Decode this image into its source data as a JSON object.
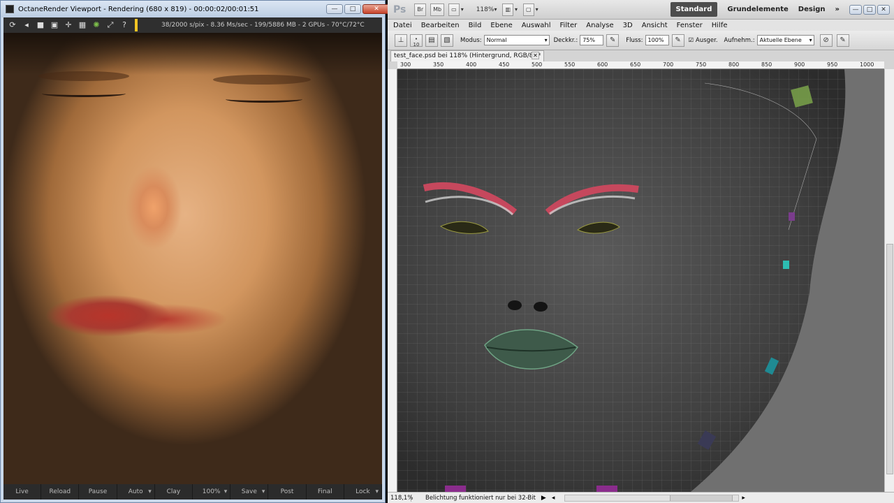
{
  "octane": {
    "title": "OctaneRender Viewport - Rendering (680 x 819) - 00:00:02/00:01:51",
    "buttons": {
      "minimize": "—",
      "maximize": "□",
      "close": "✕"
    },
    "toolbar_icons": [
      "refresh-icon",
      "back-icon",
      "stop-icon",
      "camera-icon",
      "crosshair-icon",
      "grid-icon",
      "color-wheel-icon",
      "expand-icon",
      "help-icon"
    ],
    "status": "38/2000 s/pix - 8.36 Ms/sec - 199/5886 MB - 2 GPUs - 70°C/72°C",
    "bottom_buttons": [
      {
        "label": "Live",
        "dropdown": false
      },
      {
        "label": "Reload",
        "dropdown": false
      },
      {
        "label": "Pause",
        "dropdown": false
      },
      {
        "label": "Auto",
        "dropdown": true
      },
      {
        "label": "Clay",
        "dropdown": false
      },
      {
        "label": "100%",
        "dropdown": true
      },
      {
        "label": "Save",
        "dropdown": true
      },
      {
        "label": "Post",
        "dropdown": false
      },
      {
        "label": "Final",
        "dropdown": false
      },
      {
        "label": "Lock",
        "dropdown": true
      }
    ]
  },
  "photoshop": {
    "logo": "Ps",
    "appbar": {
      "br": "Br",
      "mb": "Mb",
      "zoom": "118%"
    },
    "workspaces": {
      "active": "Standard",
      "w2": "Grundelemente",
      "w3": "Design",
      "more": "»"
    },
    "menu": [
      "Datei",
      "Bearbeiten",
      "Bild",
      "Ebene",
      "Auswahl",
      "Filter",
      "Analyse",
      "3D",
      "Ansicht",
      "Fenster",
      "Hilfe"
    ],
    "options": {
      "brush_size": "10",
      "modus_label": "Modus:",
      "modus_value": "Normal",
      "deckkraft_label": "Deckkr.:",
      "deckkraft_value": "75%",
      "fluss_label": "Fluss:",
      "fluss_value": "100%",
      "ausger_label": "Ausger.",
      "aufnehm_label": "Aufnehm.:",
      "aufnehm_value": "Aktuelle Ebene"
    },
    "doc_tab": "test_face.psd bei 118% (Hintergrund, RGB/8) *",
    "ruler_ticks": [
      "300",
      "350",
      "400",
      "450",
      "500",
      "550",
      "600",
      "650",
      "700",
      "750",
      "800",
      "850",
      "900",
      "950",
      "1000"
    ],
    "status": {
      "zoom": "118,1%",
      "info": "Belichtung funktioniert nur bei 32-Bit"
    }
  }
}
